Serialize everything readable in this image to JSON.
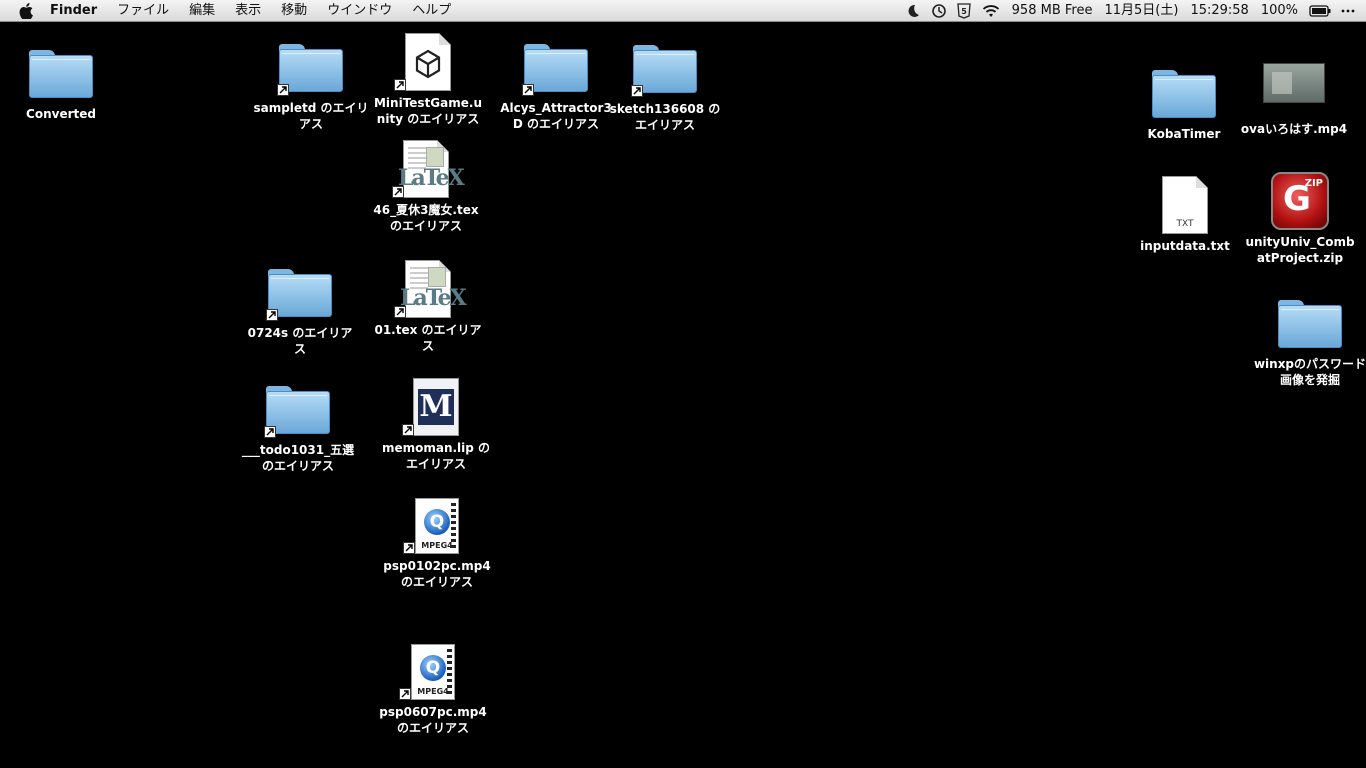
{
  "menubar": {
    "app_name": "Finder",
    "items": [
      "ファイル",
      "編集",
      "表示",
      "移動",
      "ウインドウ",
      "ヘルプ"
    ],
    "free_space": "958 MB Free",
    "date": "11月5日(土)",
    "time": "15:29:58",
    "battery": "100%"
  },
  "desktop": {
    "icons": [
      {
        "label": "Converted",
        "type": "folder"
      },
      {
        "label": "sampletd のエイリアス",
        "type": "folder-alias"
      },
      {
        "label": "MiniTestGame.unity のエイリアス",
        "type": "unity-alias"
      },
      {
        "label": "Alcys_Attractor3D のエイリアス",
        "type": "folder-alias"
      },
      {
        "label": "sketch136608 のエイリアス",
        "type": "folder-alias"
      },
      {
        "label": "46_夏休3魔女.tex のエイリアス",
        "type": "tex-alias"
      },
      {
        "label": "0724s のエイリアス",
        "type": "folder-alias"
      },
      {
        "label": "01.tex のエイリアス",
        "type": "tex-alias"
      },
      {
        "label": "___todo1031_五選 のエイリアス",
        "type": "folder-alias"
      },
      {
        "label": "memoman.lip のエイリアス",
        "type": "memoman-alias"
      },
      {
        "label": "psp0102pc.mp4 のエイリアス",
        "type": "mpeg4-alias"
      },
      {
        "label": "psp0607pc.mp4 のエイリアス",
        "type": "mpeg4-alias"
      },
      {
        "label": "KobaTimer",
        "type": "folder"
      },
      {
        "label": "ovaいろはす.mp4",
        "type": "video"
      },
      {
        "label": "inputdata.txt",
        "type": "txt"
      },
      {
        "label": "unityUniv_CombatProject.zip",
        "type": "zip"
      },
      {
        "label": "winxpのパスワード画像を発掘",
        "type": "folder"
      }
    ]
  },
  "icon_tags": {
    "txt": "TXT",
    "mpeg4": "MPEG4",
    "tex": "LaTeX",
    "memoman": "M",
    "zip": "ZIP",
    "quicktime": "Q",
    "zip_glyph": "G"
  }
}
